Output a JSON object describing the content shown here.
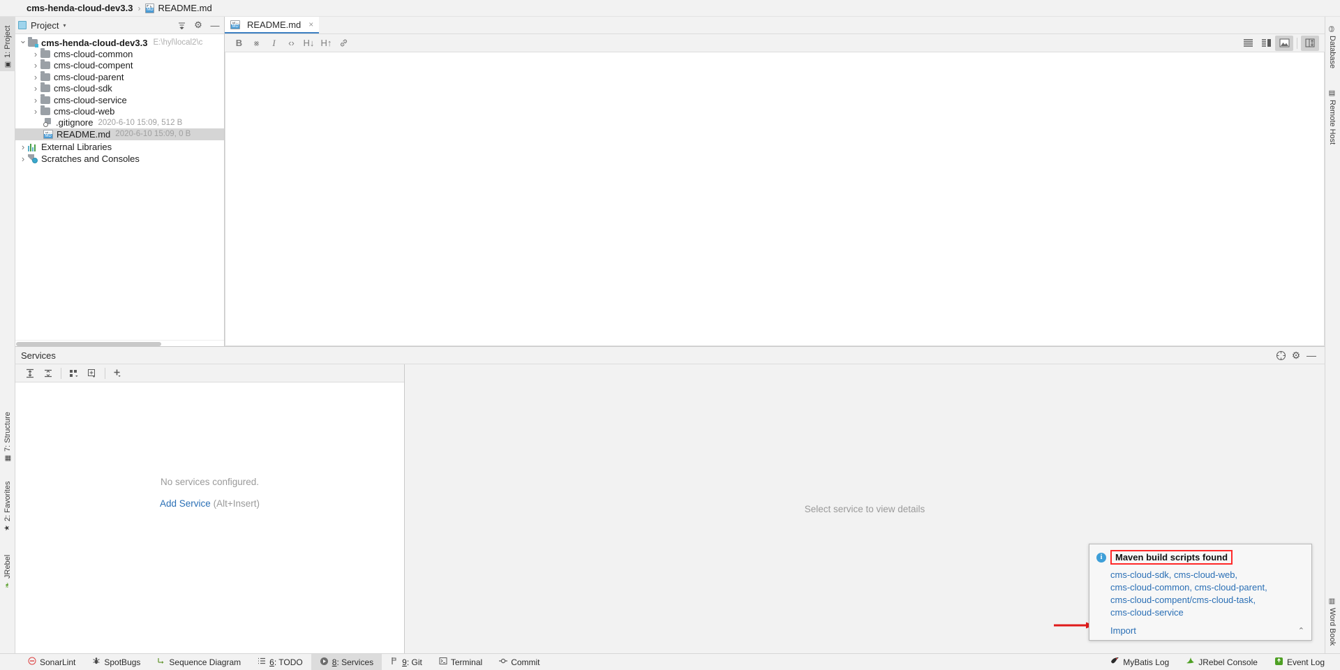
{
  "window": {
    "breadcrumb_project": "cms-henda-cloud-dev3.3",
    "breadcrumb_sep": "›",
    "breadcrumb_file": "README.md"
  },
  "left_tool_strip": [
    {
      "label": "1: Project",
      "icon": "project-icon",
      "selected": true
    },
    {
      "label": "7: Structure",
      "icon": "structure-icon",
      "selected": false
    },
    {
      "label": "2: Favorites",
      "icon": "star-icon",
      "selected": false
    },
    {
      "label": "JRebel",
      "icon": "jrebel-icon",
      "selected": false
    }
  ],
  "right_tool_strip": [
    {
      "label": "Database",
      "icon": "database-icon"
    },
    {
      "label": "Remote Host",
      "icon": "remote-host-icon"
    },
    {
      "label": "Word Book",
      "icon": "word-book-icon"
    }
  ],
  "project_pane": {
    "title": "Project",
    "caret": "▾",
    "actions": [
      {
        "name": "collapse-all-icon",
        "glyph": "≡"
      },
      {
        "name": "settings-gear-icon",
        "glyph": "⚙"
      },
      {
        "name": "hide-panel-icon",
        "glyph": "—"
      }
    ],
    "tree": [
      {
        "indent": 0,
        "arrow": "open",
        "icon": "module-folder-icon",
        "label": "cms-henda-cloud-dev3.3",
        "bold": true,
        "path": "E:\\hyl\\local2\\c",
        "meta": "",
        "selected": false
      },
      {
        "indent": 1,
        "arrow": "closed",
        "icon": "folder-icon",
        "label": "cms-cloud-common",
        "bold": false,
        "path": "",
        "meta": "",
        "selected": false
      },
      {
        "indent": 1,
        "arrow": "closed",
        "icon": "folder-icon",
        "label": "cms-cloud-compent",
        "bold": false,
        "path": "",
        "meta": "",
        "selected": false
      },
      {
        "indent": 1,
        "arrow": "closed",
        "icon": "folder-icon",
        "label": "cms-cloud-parent",
        "bold": false,
        "path": "",
        "meta": "",
        "selected": false
      },
      {
        "indent": 1,
        "arrow": "closed",
        "icon": "folder-icon",
        "label": "cms-cloud-sdk",
        "bold": false,
        "path": "",
        "meta": "",
        "selected": false
      },
      {
        "indent": 1,
        "arrow": "closed",
        "icon": "folder-icon",
        "label": "cms-cloud-service",
        "bold": false,
        "path": "",
        "meta": "",
        "selected": false
      },
      {
        "indent": 1,
        "arrow": "closed",
        "icon": "folder-icon",
        "label": "cms-cloud-web",
        "bold": false,
        "path": "",
        "meta": "",
        "selected": false
      },
      {
        "indent": 1,
        "arrow": "none",
        "icon": "gitignore-icon",
        "label": ".gitignore",
        "bold": false,
        "path": "",
        "meta": "2020-6-10 15:09, 512 B",
        "selected": false
      },
      {
        "indent": 1,
        "arrow": "none",
        "icon": "markdown-icon",
        "label": "README.md",
        "bold": false,
        "path": "",
        "meta": "2020-6-10 15:09, 0 B",
        "selected": true
      },
      {
        "indent": 0,
        "arrow": "closed",
        "icon": "libraries-icon",
        "label": "External Libraries",
        "bold": false,
        "path": "",
        "meta": "",
        "selected": false
      },
      {
        "indent": 0,
        "arrow": "closed",
        "icon": "scratches-icon",
        "label": "Scratches and Consoles",
        "bold": false,
        "path": "",
        "meta": "",
        "selected": false
      }
    ]
  },
  "editor": {
    "tab_label": "README.md",
    "tab_close": "×",
    "format_buttons": [
      {
        "name": "bold-button",
        "glyph": "B",
        "style": "b"
      },
      {
        "name": "strikethrough-button",
        "glyph": "⨳",
        "style": ""
      },
      {
        "name": "italic-button",
        "glyph": "I",
        "style": "i"
      },
      {
        "name": "code-button",
        "glyph": "‹›",
        "style": ""
      },
      {
        "name": "heading-down-button",
        "glyph": "H↓",
        "style": ""
      },
      {
        "name": "heading-up-button",
        "glyph": "H↑",
        "style": ""
      },
      {
        "name": "link-button",
        "glyph": "🔗",
        "style": ""
      }
    ],
    "view_buttons": [
      {
        "name": "show-editor-only-button",
        "active": false
      },
      {
        "name": "show-editor-and-preview-button",
        "active": false
      },
      {
        "name": "show-preview-only-button",
        "active": true
      },
      {
        "name": "toggle-split-layout-button",
        "active": true
      }
    ],
    "content": ""
  },
  "services": {
    "title": "Services",
    "header_actions": [
      {
        "name": "help-icon",
        "glyph": "ⓘ"
      },
      {
        "name": "settings-gear-icon",
        "glyph": "⚙"
      },
      {
        "name": "hide-panel-icon",
        "glyph": "—"
      }
    ],
    "toolbar": [
      {
        "name": "expand-all-icon",
        "glyph": "↧"
      },
      {
        "name": "collapse-all-icon",
        "glyph": "↥"
      },
      {
        "name": "group-by-icon",
        "glyph": "∷"
      },
      {
        "name": "add-configuration-icon",
        "glyph": "⊞"
      },
      {
        "name": "add-service-icon",
        "glyph": "＋"
      }
    ],
    "empty_message": "No services configured.",
    "add_service_link": "Add Service",
    "add_service_hint": "(Alt+Insert)",
    "detail_placeholder": "Select service to view details"
  },
  "notification": {
    "title": "Maven build scripts found",
    "info_glyph": "i",
    "lines": [
      "cms-cloud-sdk, cms-cloud-web,",
      "cms-cloud-common, cms-cloud-parent,",
      "cms-cloud-compent/cms-cloud-task,",
      "cms-cloud-service"
    ],
    "action_label": "Import",
    "collapse_glyph": "⌃",
    "highlight_color": "#ff2a2a",
    "link_color": "#2a6fb5"
  },
  "statusbar": {
    "left_items": [
      {
        "name": "sonarlint",
        "label": "SonarLint",
        "icon": "sonarlint-icon",
        "num": "",
        "selected": false
      },
      {
        "name": "spotbugs",
        "label": "SpotBugs",
        "icon": "spotbugs-icon",
        "num": "",
        "selected": false
      },
      {
        "name": "sequence-diagram",
        "label": "Sequence Diagram",
        "icon": "sequence-diagram-icon",
        "num": "",
        "selected": false
      },
      {
        "name": "todo",
        "label": ": TODO",
        "icon": "todo-icon",
        "num": "6",
        "selected": false
      },
      {
        "name": "services",
        "label": ": Services",
        "icon": "services-icon",
        "num": "8",
        "selected": true
      },
      {
        "name": "git",
        "label": ": Git",
        "icon": "git-icon",
        "num": "9",
        "selected": false
      },
      {
        "name": "terminal",
        "label": "Terminal",
        "icon": "terminal-icon",
        "num": "",
        "selected": false
      },
      {
        "name": "commit",
        "label": "Commit",
        "icon": "commit-icon",
        "num": "",
        "selected": false
      }
    ],
    "right_items": [
      {
        "name": "mybatis-log",
        "label": "MyBatis Log",
        "icon": "mybatis-icon"
      },
      {
        "name": "jrebel-console",
        "label": "JRebel Console",
        "icon": "jrebel-icon"
      },
      {
        "name": "event-log",
        "label": "Event Log",
        "icon": "event-log-icon"
      }
    ]
  }
}
